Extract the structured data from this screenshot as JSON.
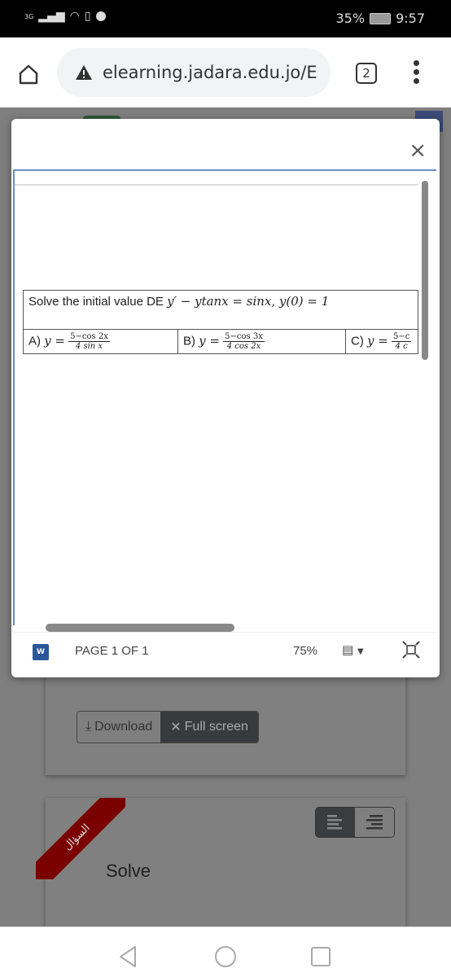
{
  "status_bar": {
    "network": "3G",
    "battery": "35%",
    "time": "9:57"
  },
  "browser": {
    "url": "elearning.jadara.edu.jo/E",
    "tab_count": "2"
  },
  "modal": {
    "close_label": "×",
    "question": {
      "prefix": "Solve the initial value DE",
      "equation": "y′ − ytanx = sinx,  y(0) = 1"
    },
    "options": [
      {
        "label": "A)",
        "lhs": "y =",
        "numerator": "5−cos 2x",
        "denominator": "4 sin x"
      },
      {
        "label": "B)",
        "lhs": "y =",
        "numerator": "5−cos 3x",
        "denominator": "4 cos 2x"
      },
      {
        "label": "C)",
        "lhs": "y =",
        "numerator": "5−c",
        "denominator": "4 c"
      }
    ],
    "viewer_status": {
      "app_icon": "W",
      "page_label": "PAGE 1 OF 1",
      "zoom": "75%"
    }
  },
  "background": {
    "download_label": "Download",
    "fullscreen_label": "Full screen",
    "ribbon_label": "السؤال",
    "question_text": "Solve"
  }
}
